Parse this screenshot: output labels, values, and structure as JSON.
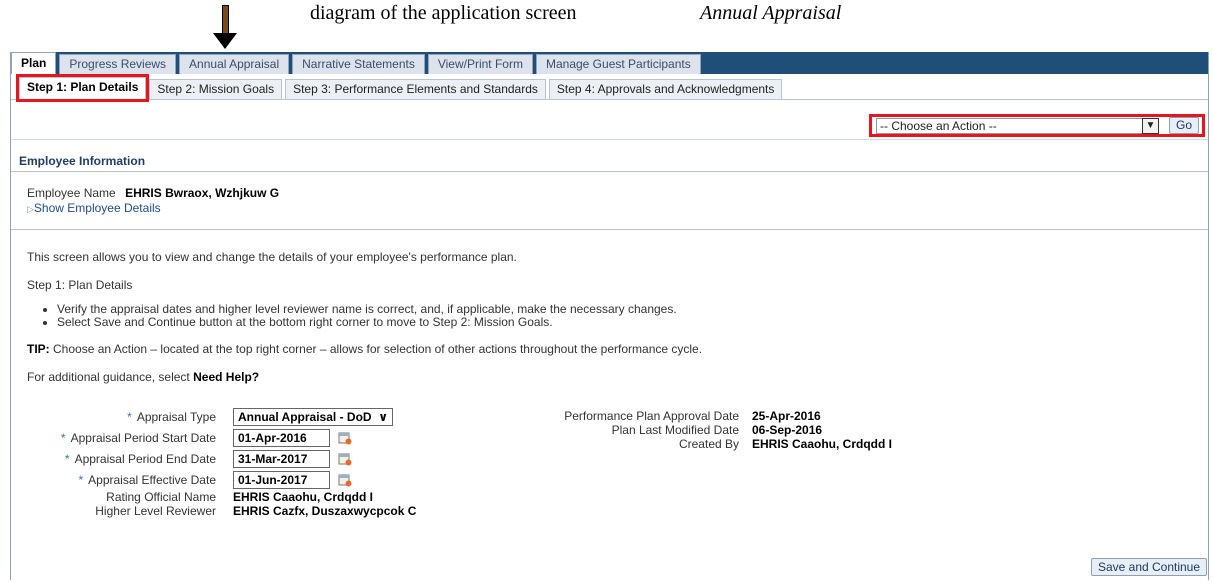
{
  "caption": {
    "text_plain": "diagram of the application screen",
    "text_italic": "Annual Appraisal"
  },
  "top_tabs": [
    {
      "label": "Plan",
      "active": true
    },
    {
      "label": "Progress Reviews"
    },
    {
      "label": "Annual Appraisal"
    },
    {
      "label": "Narrative Statements"
    },
    {
      "label": "View/Print Form"
    },
    {
      "label": "Manage Guest Participants"
    }
  ],
  "sub_tabs": [
    {
      "label": "Step 1: Plan Details",
      "active": true
    },
    {
      "label": "Step 2: Mission Goals"
    },
    {
      "label": "Step 3: Performance Elements and Standards"
    },
    {
      "label": "Step 4: Approvals and Acknowledgments"
    }
  ],
  "action": {
    "select_value": "-- Choose an Action --",
    "go_label": "Go"
  },
  "employee_section": {
    "title": "Employee Information",
    "name_label": "Employee Name",
    "name_value": "EHRIS Bwraox, Wzhjkuw G",
    "details_link": "Show Employee Details"
  },
  "instructions": {
    "intro": "This screen allows you to view and change the details of your employee's performance plan.",
    "step_heading": "Step 1: Plan Details",
    "bullets": [
      "Verify the appraisal dates and higher level reviewer name is correct, and, if applicable, make the necessary changes.",
      "Select Save and Continue button at the bottom right corner to move to Step 2: Mission Goals."
    ],
    "tip_label": "TIP:",
    "tip_text": "Choose an Action – located at the top right corner – allows for selection of other actions throughout the performance cycle.",
    "help_prefix": "For additional guidance, select",
    "help_bold": "Need Help?"
  },
  "form": {
    "required_marker": "*",
    "appraisal_type_label": "Appraisal Type",
    "appraisal_type_value": "Annual Appraisal - DoD",
    "start_label": "Appraisal Period Start Date",
    "start_value": "01-Apr-2016",
    "end_label": "Appraisal Period End Date",
    "end_value": "31-Mar-2017",
    "effective_label": "Appraisal Effective Date",
    "effective_value": "01-Jun-2017",
    "rating_official_label": "Rating Official Name",
    "rating_official_value": "EHRIS Caaohu, Crdqdd I",
    "reviewer_label": "Higher Level Reviewer",
    "reviewer_value": "EHRIS Cazfx, Duszaxwycpcok C",
    "approval_date_label": "Performance Plan Approval Date",
    "approval_date_value": "25-Apr-2016",
    "modified_label": "Plan Last Modified Date",
    "modified_value": "06-Sep-2016",
    "created_label": "Created By",
    "created_value": "EHRIS Caaohu, Crdqdd I"
  },
  "footer": {
    "save_label": "Save and Continue"
  },
  "colors": {
    "header_bar": "#1f4e79",
    "highlight": "#e8141e",
    "link": "#1d4d86"
  }
}
